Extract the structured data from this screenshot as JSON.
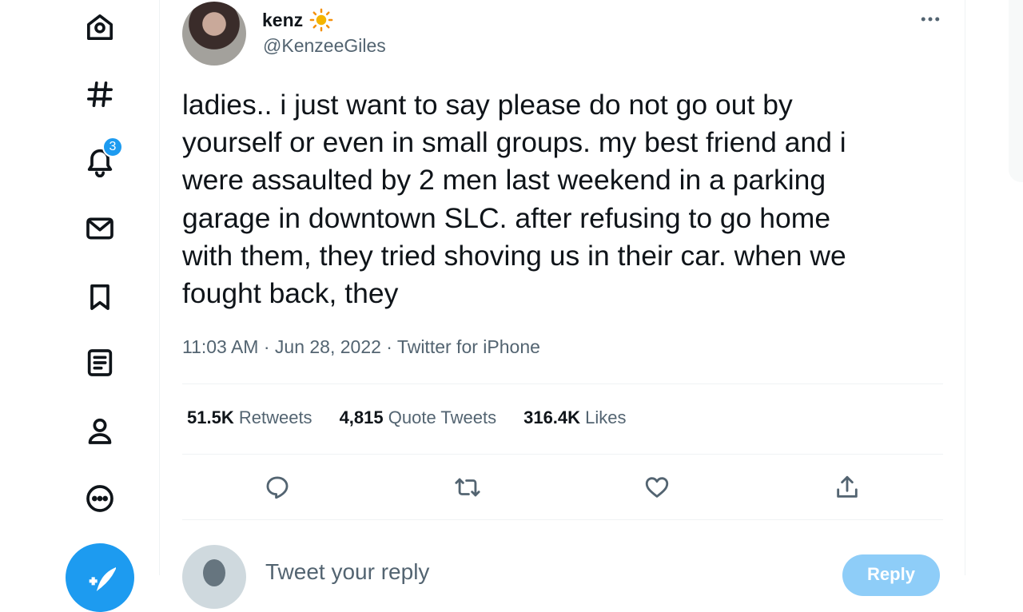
{
  "nav": {
    "items": [
      "Home",
      "Explore",
      "Notifications",
      "Messages",
      "Bookmarks",
      "Lists",
      "Profile",
      "More"
    ],
    "notifications_badge": "3"
  },
  "tweet": {
    "display_name": "kenz",
    "emoji": "sun-icon",
    "handle": "@KenzeeGiles",
    "text": "ladies.. i just want to say please do not go out by\nyourself or even in small groups. my best friend and i\nwere assaulted by 2 men last weekend in a parking\ngarage in downtown SLC. after refusing to go home\nwith them, they tried shoving us in their car. when we\nfought back, they",
    "timestamp": "11:03 AM · Jun 28, 2022 · Twitter for iPhone",
    "stats": {
      "retweets_count": "51.5K",
      "retweets_label": "Retweets",
      "quotes_count": "4,815",
      "quotes_label": "Quote Tweets",
      "likes_count": "316.4K",
      "likes_label": "Likes"
    }
  },
  "reply": {
    "placeholder": "Tweet your reply",
    "button": "Reply"
  },
  "colors": {
    "accent": "#1d9bf0",
    "text": "#0f1419",
    "secondary": "#536471",
    "divider": "#eff3f4"
  }
}
